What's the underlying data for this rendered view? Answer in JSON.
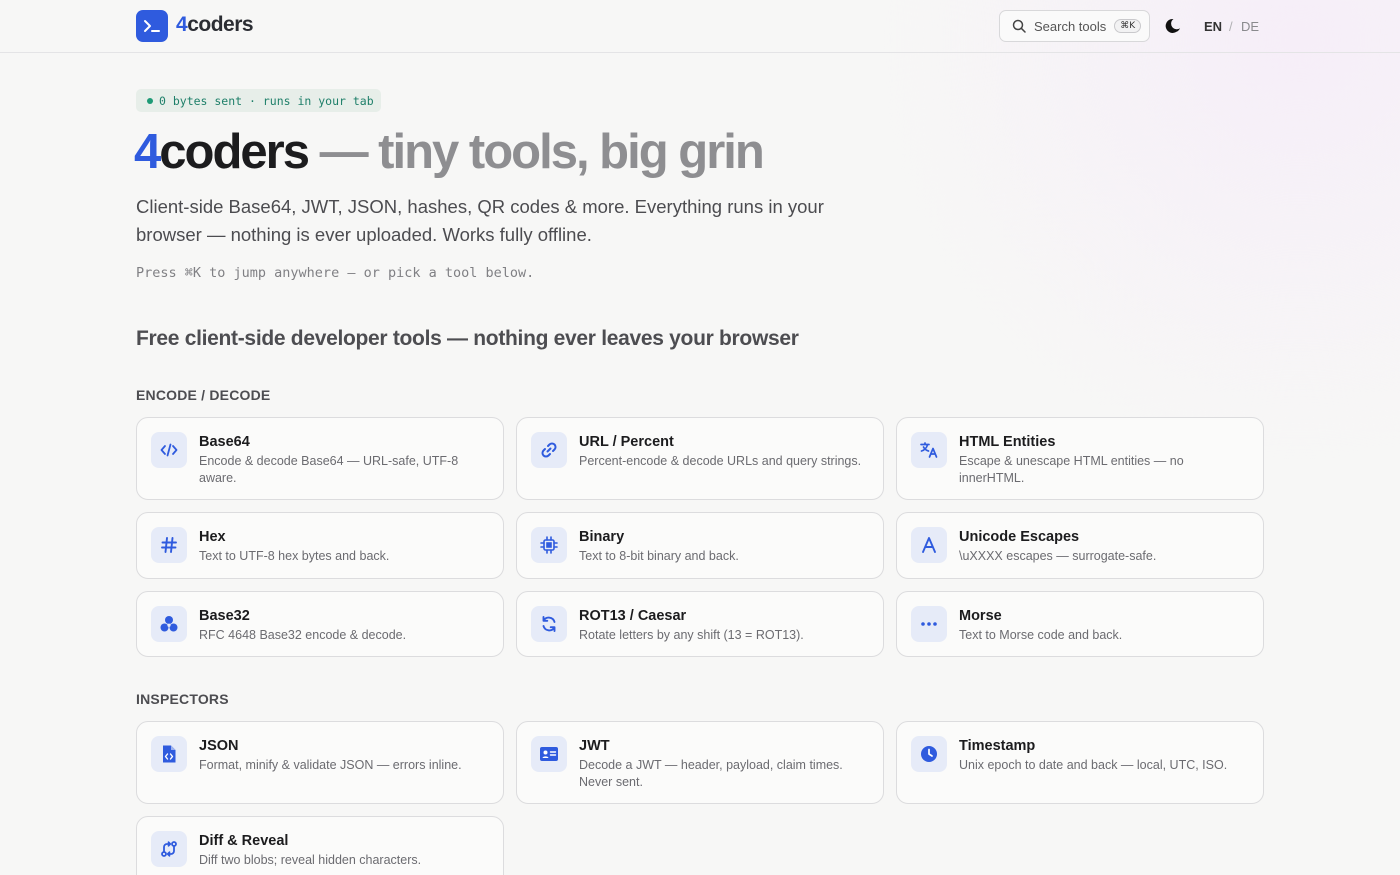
{
  "header": {
    "logo_four": "4",
    "logo_rest": "coders",
    "search_label": "Search tools",
    "search_kbd": "⌘K",
    "lang_en": "EN",
    "lang_sep": "/",
    "lang_de": "DE"
  },
  "hero": {
    "badge": "0 bytes sent · runs in your tab",
    "title_four": "4",
    "title_brand": "coders",
    "title_tag": " — tiny tools, big grin",
    "subtitle": "Client-side Base64, JWT, JSON, hashes, QR codes & more. Everything runs in your browser — nothing is ever uploaded. Works fully offline.",
    "hint": "Press ⌘K to jump anywhere — or pick a tool below."
  },
  "section_heading": "Free client-side developer tools — nothing ever leaves your browser",
  "categories": [
    {
      "name": "ENCODE / DECODE",
      "tools": [
        {
          "title": "Base64",
          "desc": "Encode & decode Base64 — URL-safe, UTF-8 aware.",
          "icon": "code-icon"
        },
        {
          "title": "URL / Percent",
          "desc": "Percent-encode & decode URLs and query strings.",
          "icon": "link-icon"
        },
        {
          "title": "HTML Entities",
          "desc": "Escape & unescape HTML entities — no innerHTML.",
          "icon": "translate-icon"
        },
        {
          "title": "Hex",
          "desc": "Text to UTF-8 hex bytes and back.",
          "icon": "hash-icon"
        },
        {
          "title": "Binary",
          "desc": "Text to 8-bit binary and back.",
          "icon": "chip-icon"
        },
        {
          "title": "Unicode Escapes",
          "desc": "\\uXXXX escapes — surrogate-safe.",
          "icon": "letter-a-icon"
        },
        {
          "title": "Base32",
          "desc": "RFC 4648 Base32 encode & decode.",
          "icon": "shapes-icon"
        },
        {
          "title": "ROT13 / Caesar",
          "desc": "Rotate letters by any shift (13 = ROT13).",
          "icon": "refresh-icon"
        },
        {
          "title": "Morse",
          "desc": "Text to Morse code and back.",
          "icon": "dots-icon"
        }
      ]
    },
    {
      "name": "INSPECTORS",
      "tools": [
        {
          "title": "JSON",
          "desc": "Format, minify & validate JSON — errors inline.",
          "icon": "code-file-icon"
        },
        {
          "title": "JWT",
          "desc": "Decode a JWT — header, payload, claim times. Never sent.",
          "icon": "id-card-icon"
        },
        {
          "title": "Timestamp",
          "desc": "Unix epoch to date and back — local, UTC, ISO.",
          "icon": "clock-icon"
        },
        {
          "title": "Diff & Reveal",
          "desc": "Diff two blobs; reveal hidden characters.",
          "icon": "diff-icon"
        }
      ]
    }
  ],
  "colors": {
    "accent": "#2f5bde",
    "badge_text": "#1e7f69"
  }
}
